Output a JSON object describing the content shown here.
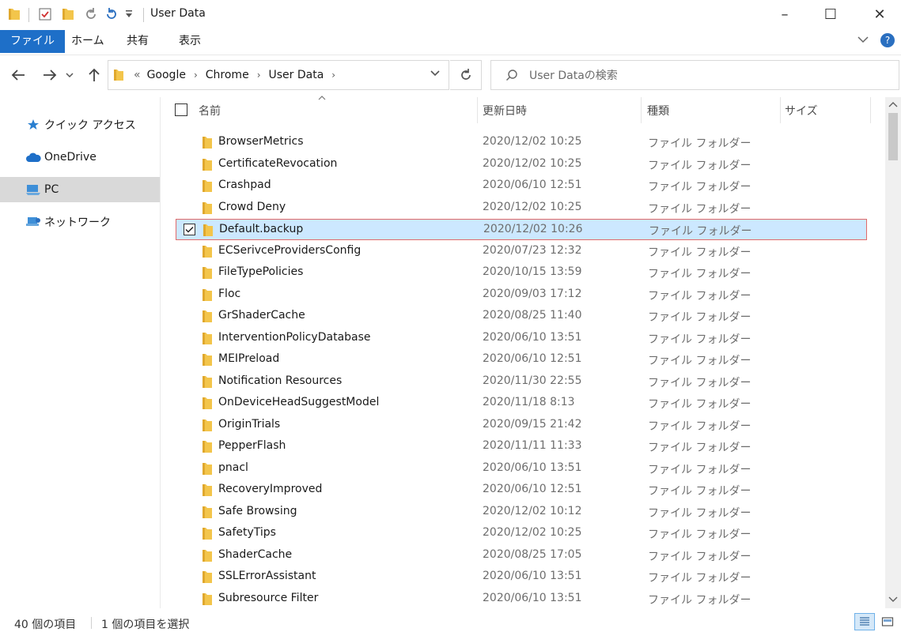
{
  "window": {
    "title": "User Data",
    "minimize": "–",
    "maximize": "☐",
    "close": "✕"
  },
  "ribbon": {
    "tabs": [
      "ファイル",
      "ホーム",
      "共有",
      "表示"
    ],
    "expand": "⌄",
    "help": "?"
  },
  "address": {
    "overflow": "«",
    "crumbs": [
      "Google",
      "Chrome",
      "User Data"
    ],
    "separator": "›"
  },
  "search": {
    "placeholder": "User Dataの検索"
  },
  "sidebar": {
    "items": [
      {
        "label": "クイック アクセス",
        "icon": "star-icon"
      },
      {
        "label": "OneDrive",
        "icon": "cloud-icon"
      },
      {
        "label": "PC",
        "icon": "computer-icon"
      },
      {
        "label": "ネットワーク",
        "icon": "network-icon"
      }
    ],
    "selected": "PC"
  },
  "columns": {
    "name": "名前",
    "date": "更新日時",
    "type": "種類",
    "size": "サイズ"
  },
  "files": [
    {
      "name": "BrowserMetrics",
      "date": "2020/12/02 10:25",
      "type": "ファイル フォルダー"
    },
    {
      "name": "CertificateRevocation",
      "date": "2020/12/02 10:25",
      "type": "ファイル フォルダー"
    },
    {
      "name": "Crashpad",
      "date": "2020/06/10 12:51",
      "type": "ファイル フォルダー"
    },
    {
      "name": "Crowd Deny",
      "date": "2020/12/02 10:25",
      "type": "ファイル フォルダー"
    },
    {
      "name": "Default.backup",
      "date": "2020/12/02 10:26",
      "type": "ファイル フォルダー",
      "selected": true
    },
    {
      "name": "ECSerivceProvidersConfig",
      "date": "2020/07/23 12:32",
      "type": "ファイル フォルダー"
    },
    {
      "name": "FileTypePolicies",
      "date": "2020/10/15 13:59",
      "type": "ファイル フォルダー"
    },
    {
      "name": "Floc",
      "date": "2020/09/03 17:12",
      "type": "ファイル フォルダー"
    },
    {
      "name": "GrShaderCache",
      "date": "2020/08/25 11:40",
      "type": "ファイル フォルダー"
    },
    {
      "name": "InterventionPolicyDatabase",
      "date": "2020/06/10 13:51",
      "type": "ファイル フォルダー"
    },
    {
      "name": "MEIPreload",
      "date": "2020/06/10 12:51",
      "type": "ファイル フォルダー"
    },
    {
      "name": "Notification Resources",
      "date": "2020/11/30 22:55",
      "type": "ファイル フォルダー"
    },
    {
      "name": "OnDeviceHeadSuggestModel",
      "date": "2020/11/18 8:13",
      "type": "ファイル フォルダー"
    },
    {
      "name": "OriginTrials",
      "date": "2020/09/15 21:42",
      "type": "ファイル フォルダー"
    },
    {
      "name": "PepperFlash",
      "date": "2020/11/11 11:33",
      "type": "ファイル フォルダー"
    },
    {
      "name": "pnacl",
      "date": "2020/06/10 13:51",
      "type": "ファイル フォルダー"
    },
    {
      "name": "RecoveryImproved",
      "date": "2020/06/10 12:51",
      "type": "ファイル フォルダー"
    },
    {
      "name": "Safe Browsing",
      "date": "2020/12/02 10:12",
      "type": "ファイル フォルダー"
    },
    {
      "name": "SafetyTips",
      "date": "2020/12/02 10:25",
      "type": "ファイル フォルダー"
    },
    {
      "name": "ShaderCache",
      "date": "2020/08/25 17:05",
      "type": "ファイル フォルダー"
    },
    {
      "name": "SSLErrorAssistant",
      "date": "2020/06/10 13:51",
      "type": "ファイル フォルダー"
    },
    {
      "name": "Subresource Filter",
      "date": "2020/06/10 13:51",
      "type": "ファイル フォルダー"
    }
  ],
  "status": {
    "count": "40 個の項目",
    "selection": "1 個の項目を選択"
  },
  "colors": {
    "accent": "#1e6fc8",
    "selection_bg": "#cce8ff",
    "selection_border": "#e06a6a",
    "folder": "#f3c54b"
  }
}
